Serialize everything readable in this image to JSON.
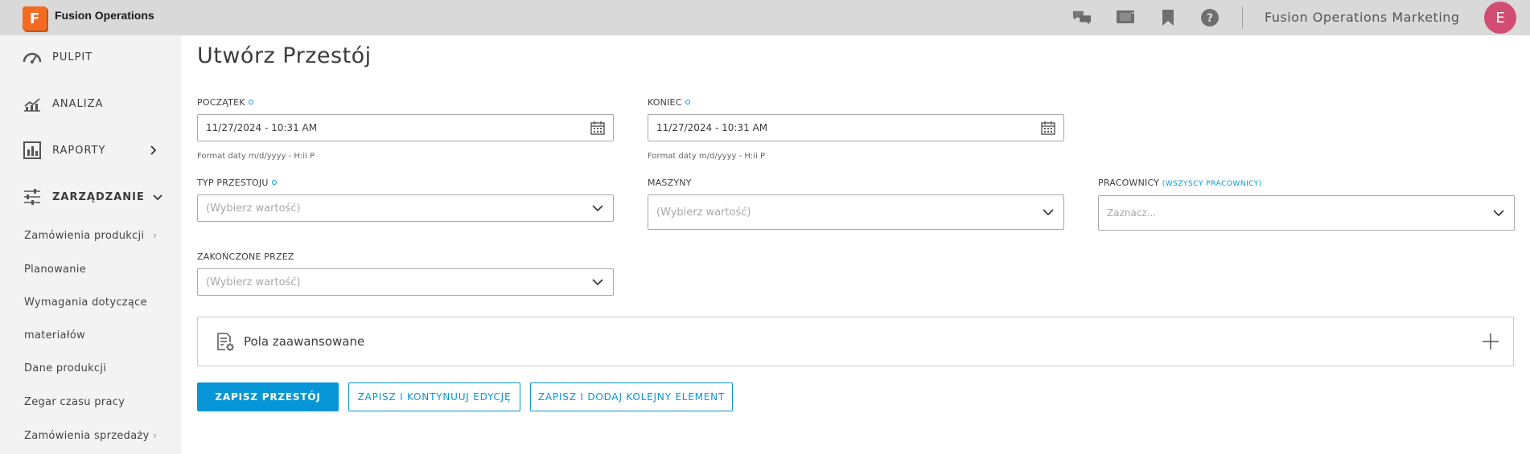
{
  "app": {
    "logo_letter": "F",
    "name": "Fusion Operations",
    "org_name": "Fusion Operations Marketing",
    "avatar_initial": "E"
  },
  "topbar_icons": [
    "chat-icon",
    "screen-icon",
    "bookmark-icon",
    "help-icon"
  ],
  "sidebar": {
    "main_items": [
      {
        "label": "PULPIT",
        "icon": "dashboard-icon"
      },
      {
        "label": "ANALIZA",
        "icon": "analytics-icon"
      },
      {
        "label": "RAPORTY",
        "icon": "reports-icon",
        "chevron": "right"
      },
      {
        "label": "ZARZĄDZANIE",
        "icon": "sliders-icon",
        "chevron": "down"
      }
    ],
    "sub_items": [
      {
        "label": "Zamówienia produkcji",
        "arrow": "›"
      },
      {
        "label": "Planowanie"
      },
      {
        "label": "Wymagania dotyczące"
      },
      {
        "label": "materiałów"
      },
      {
        "label": "Dane produkcji"
      },
      {
        "label": "Zegar czasu pracy"
      },
      {
        "label": "Zamówienia sprzedaży",
        "arrow": "›"
      }
    ]
  },
  "form": {
    "title": "Utwórz Przestój",
    "start": {
      "label": "POCZĄTEK",
      "value": "11/27/2024 - 10:31 AM",
      "hint": "Format daty m/d/yyyy - H:ii P"
    },
    "end": {
      "label": "KONIEC",
      "value": "11/27/2024 - 10:31 AM",
      "hint": "Format daty m/d/yyyy - H:ii P"
    },
    "downtime_type": {
      "label": "TYP PRZESTOJU",
      "placeholder": "(Wybierz wartość)"
    },
    "machines": {
      "label": "MASZYNY",
      "placeholder": "(Wybierz wartość)"
    },
    "workers": {
      "label": "PRACOWNICY",
      "link": "(WSZYSCY PRACOWNICY)",
      "placeholder": "Zaznacz..."
    },
    "finished_by": {
      "label": "ZAKOŃCZONE PRZEZ",
      "placeholder": "(Wybierz wartość)"
    },
    "advanced": {
      "label": "Pola zaawansowane"
    },
    "buttons": {
      "save": "ZAPISZ PRZESTÓJ",
      "save_continue": "ZAPISZ I KONTYNUUJ EDYCJĘ",
      "save_add": "ZAPISZ I DODAJ KOLEJNY ELEMENT"
    }
  },
  "colors": {
    "accent": "#0696d7",
    "logo": "#f26b21",
    "avatar": "#d14d72",
    "sidebar_bg": "#f3f3f3",
    "topbar_bg": "#d9d9d9"
  }
}
